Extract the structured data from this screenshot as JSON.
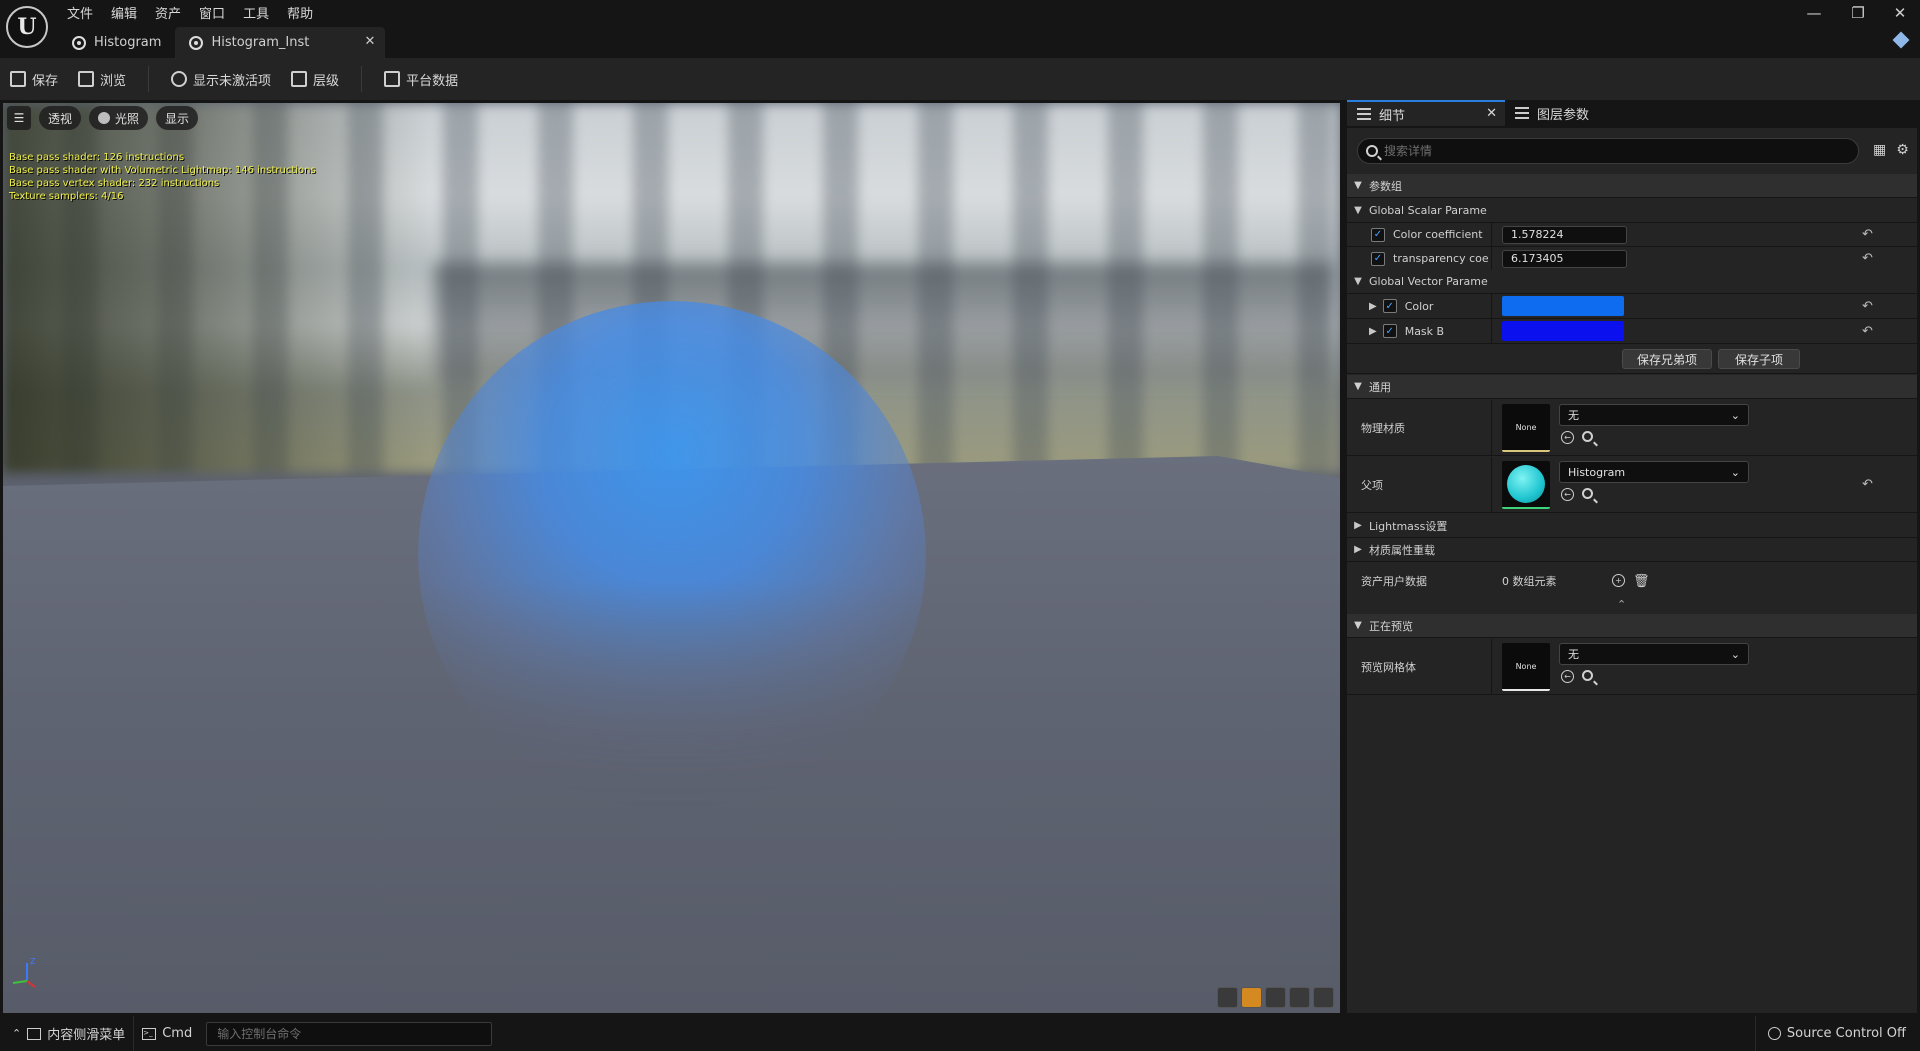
{
  "menu": [
    "文件",
    "编辑",
    "资产",
    "窗口",
    "工具",
    "帮助"
  ],
  "doc_tabs": [
    {
      "label": "Histogram"
    },
    {
      "label": "Histogram_Inst"
    }
  ],
  "window_controls": {
    "minimize": "—",
    "maximize": "❐",
    "close": "✕"
  },
  "toolbar": {
    "save": "保存",
    "browse": "浏览",
    "show_inactive": "显示未激活项",
    "hierarchy": "层级",
    "platform_stats": "平台数据"
  },
  "viewport": {
    "menu_glyph": "☰",
    "perspective": "透视",
    "lit": "光照",
    "show": "显示",
    "stats": [
      "Base pass shader: 126 instructions",
      "Base pass shader with Volumetric Lightmap: 146 instructions",
      "Base pass vertex shader: 232 instructions",
      "Texture samplers: 4/16"
    ],
    "axis_z": "Z"
  },
  "panel": {
    "tab_details": "细节",
    "tab_layer_params": "图层参数",
    "search_placeholder": "搜索详情",
    "param_groups": "参数组",
    "global_scalar": "Global Scalar Parame",
    "scalars": [
      {
        "label": "Color coefficient",
        "value": "1.578224"
      },
      {
        "label": "transparency coe",
        "value": "6.173405"
      }
    ],
    "global_vector": "Global Vector Parame",
    "vectors": [
      {
        "label": "Color",
        "color": "#0d6cf0"
      },
      {
        "label": "Mask B",
        "color": "#0a10ee"
      }
    ],
    "save_siblings": "保存兄弟项",
    "save_children": "保存子项",
    "general": "通用",
    "phys_material_label": "物理材质",
    "phys_material_thumb": "None",
    "phys_material_value": "无",
    "parent_label": "父项",
    "parent_value": "Histogram",
    "lightmass": "Lightmass设置",
    "material_overrides": "材质属性重载",
    "asset_user_data_label": "资产用户数据",
    "asset_user_data_value": "0 数组元素",
    "previewing": "正在预览",
    "preview_mesh_label": "预览网格体",
    "preview_mesh_thumb": "None",
    "preview_mesh_value": "无"
  },
  "statusbar": {
    "content_drawer": "内容侧滑菜单",
    "cmd": "Cmd",
    "console_placeholder": "输入控制台命令",
    "source_control": "Source Control Off"
  }
}
